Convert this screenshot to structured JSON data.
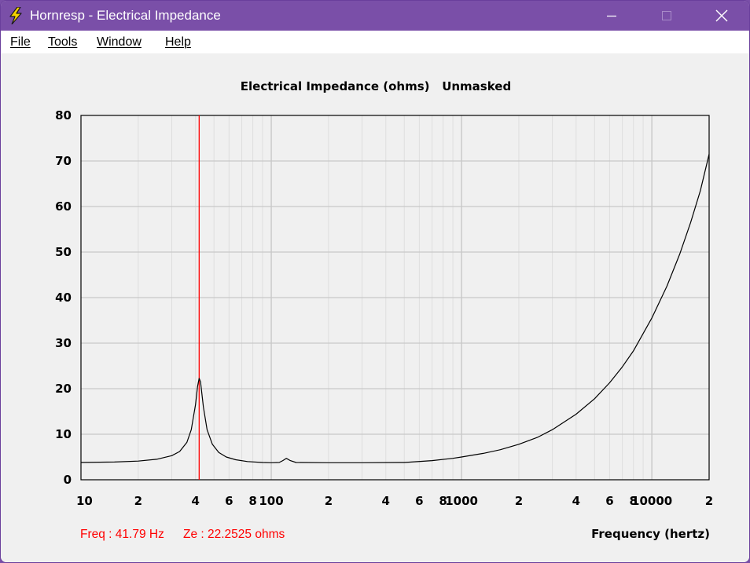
{
  "window": {
    "title": "Hornresp - Electrical Impedance",
    "controls": {
      "minimize": "minimize",
      "maximize": "maximize",
      "close": "close"
    }
  },
  "menu": {
    "items": [
      {
        "name": "menu-file",
        "label": "File"
      },
      {
        "name": "menu-tools",
        "label": "Tools"
      },
      {
        "name": "menu-window",
        "label": "Window"
      },
      {
        "name": "menu-help",
        "label": "Help"
      }
    ]
  },
  "colors": {
    "titlebar": "#7a4fa8",
    "curve": "#000000",
    "marker": "#ff0000",
    "major_grid": "#c8c8c8",
    "minor_grid": "#dedede"
  },
  "chart_data": {
    "type": "line",
    "title": "Electrical Impedance (ohms)   Unmasked",
    "xlabel": "Frequency (hertz)",
    "ylabel": "",
    "x_scale": "log",
    "xlim": [
      10,
      20000
    ],
    "ylim": [
      0,
      80
    ],
    "y_ticks": [
      0,
      10,
      20,
      30,
      40,
      50,
      60,
      70,
      80
    ],
    "x_ticks": [
      {
        "value": 10,
        "label": "10"
      },
      {
        "value": 20,
        "label": "2"
      },
      {
        "value": 40,
        "label": "4"
      },
      {
        "value": 60,
        "label": "6"
      },
      {
        "value": 80,
        "label": "8"
      },
      {
        "value": 100,
        "label": "100"
      },
      {
        "value": 200,
        "label": "2"
      },
      {
        "value": 400,
        "label": "4"
      },
      {
        "value": 600,
        "label": "6"
      },
      {
        "value": 800,
        "label": "8"
      },
      {
        "value": 1000,
        "label": "1000"
      },
      {
        "value": 2000,
        "label": "2"
      },
      {
        "value": 4000,
        "label": "4"
      },
      {
        "value": 6000,
        "label": "6"
      },
      {
        "value": 8000,
        "label": "8"
      },
      {
        "value": 10000,
        "label": "10000"
      },
      {
        "value": 20000,
        "label": "2"
      }
    ],
    "grid": true,
    "series": [
      {
        "points": [
          [
            10,
            3.8
          ],
          [
            15,
            3.9
          ],
          [
            20,
            4.1
          ],
          [
            25,
            4.5
          ],
          [
            30,
            5.3
          ],
          [
            33,
            6.2
          ],
          [
            36,
            8.2
          ],
          [
            38,
            11.0
          ],
          [
            40,
            16.5
          ],
          [
            41,
            20.5
          ],
          [
            41.79,
            22.25
          ],
          [
            42.5,
            21.5
          ],
          [
            44,
            16.0
          ],
          [
            46,
            11.0
          ],
          [
            49,
            7.8
          ],
          [
            53,
            6.0
          ],
          [
            58,
            5.0
          ],
          [
            65,
            4.4
          ],
          [
            75,
            4.0
          ],
          [
            90,
            3.8
          ],
          [
            100,
            3.75
          ],
          [
            110,
            3.8
          ],
          [
            115,
            4.2
          ],
          [
            120,
            4.7
          ],
          [
            126,
            4.2
          ],
          [
            135,
            3.8
          ],
          [
            200,
            3.75
          ],
          [
            300,
            3.75
          ],
          [
            500,
            3.8
          ],
          [
            700,
            4.2
          ],
          [
            900,
            4.7
          ],
          [
            1000,
            5.0
          ],
          [
            1300,
            5.8
          ],
          [
            1600,
            6.6
          ],
          [
            2000,
            7.8
          ],
          [
            2500,
            9.3
          ],
          [
            3000,
            11.0
          ],
          [
            4000,
            14.4
          ],
          [
            5000,
            17.8
          ],
          [
            6000,
            21.3
          ],
          [
            7000,
            24.8
          ],
          [
            8000,
            28.3
          ],
          [
            10000,
            35.5
          ],
          [
            12000,
            42.5
          ],
          [
            14000,
            49.5
          ],
          [
            16000,
            56.5
          ],
          [
            18000,
            63.5
          ],
          [
            20000,
            71.5
          ]
        ]
      }
    ],
    "marker": {
      "freq": 41.79
    },
    "readout": {
      "freq_text": "Freq : 41.79 Hz",
      "ze_text": "Ze : 22.2525 ohms"
    }
  }
}
